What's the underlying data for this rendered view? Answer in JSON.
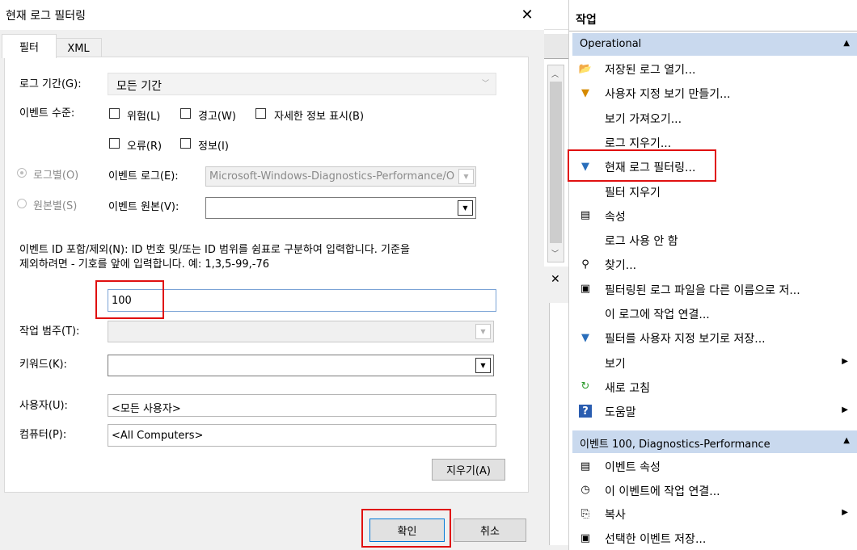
{
  "dialog": {
    "title": "현재 로그 필터링",
    "close_glyph": "✕",
    "tabs": [
      "필터",
      "XML"
    ],
    "logged": {
      "label": "로그 기간(G):",
      "value": "모든 기간"
    },
    "event_level": {
      "label": "이벤트 수준:",
      "options": [
        "위험(L)",
        "경고(W)",
        "자세한 정보 표시(B)",
        "오류(R)",
        "정보(I)"
      ]
    },
    "by_log": {
      "label": "로그별(O)",
      "field_label": "이벤트 로그(E):",
      "value": "Microsoft-Windows-Diagnostics-Performance/O"
    },
    "by_source": {
      "label": "원본별(S)",
      "field_label": "이벤트 원본(V):",
      "value": ""
    },
    "event_ids": {
      "description_line1": "이벤트 ID 포함/제외(N): ID 번호 및/또는 ID 범위를 쉼표로 구분하여 입력합니다. 기준을",
      "description_line2": "제외하려면 - 기호를 앞에 입력합니다. 예: 1,3,5-99,-76",
      "value": "100"
    },
    "task_category": {
      "label": "작업 범주(T):"
    },
    "keywords": {
      "label": "키워드(K):"
    },
    "user": {
      "label": "사용자(U):",
      "value": "<모든 사용자>"
    },
    "computer": {
      "label": "컴퓨터(P):",
      "value": "<All Computers>"
    },
    "clear_label": "지우기(A)",
    "ok_label": "확인",
    "cancel_label": "취소"
  },
  "mid_strip": {
    "close_glyph": "✕"
  },
  "actions": {
    "header": "작업",
    "section1": {
      "title": "Operational",
      "items": [
        {
          "label": "저장된 로그 열기...",
          "icon": "folder-open-icon",
          "glyph": "📂"
        },
        {
          "label": "사용자 지정 보기 만들기...",
          "icon": "create-view-filter-icon",
          "glyph": "▼"
        },
        {
          "label": "보기 가져오기...",
          "icon": "",
          "glyph": ""
        },
        {
          "label": "로그 지우기...",
          "icon": "",
          "glyph": ""
        },
        {
          "label": "현재 로그 필터링...",
          "icon": "filter-icon",
          "glyph": "▼"
        },
        {
          "label": "필터 지우기",
          "icon": "",
          "glyph": ""
        },
        {
          "label": "속성",
          "icon": "properties-icon",
          "glyph": "▤"
        },
        {
          "label": "로그 사용 안 함",
          "icon": "",
          "glyph": ""
        },
        {
          "label": "찾기...",
          "icon": "binoculars-icon",
          "glyph": "⚲"
        },
        {
          "label": "필터링된 로그 파일을 다른 이름으로 저...",
          "icon": "save-icon",
          "glyph": "▣"
        },
        {
          "label": "이 로그에 작업 연결...",
          "icon": "",
          "glyph": ""
        },
        {
          "label": "필터를 사용자 지정 보기로 저장...",
          "icon": "save-filter-icon",
          "glyph": "▼"
        },
        {
          "label": "보기",
          "icon": "",
          "glyph": "",
          "submenu": "▶"
        },
        {
          "label": "새로 고침",
          "icon": "refresh-icon",
          "glyph": "↻"
        },
        {
          "label": "도움말",
          "icon": "help-icon",
          "glyph": "?",
          "submenu": "▶"
        }
      ]
    },
    "section2": {
      "title": "이벤트 100, Diagnostics-Performance",
      "items": [
        {
          "label": "이벤트 속성",
          "icon": "event-properties-icon",
          "glyph": "▤"
        },
        {
          "label": "이 이벤트에 작업 연결...",
          "icon": "attach-task-icon",
          "glyph": "◷"
        },
        {
          "label": "복사",
          "icon": "copy-icon",
          "glyph": "⎘",
          "submenu": "▶"
        },
        {
          "label": "선택한 이벤트 저장...",
          "icon": "save-event-icon",
          "glyph": "▣"
        }
      ]
    },
    "collapse_glyph": "▲",
    "colors": {
      "section_header": "#c9d9ee",
      "highlight_box": "#e01010"
    }
  }
}
